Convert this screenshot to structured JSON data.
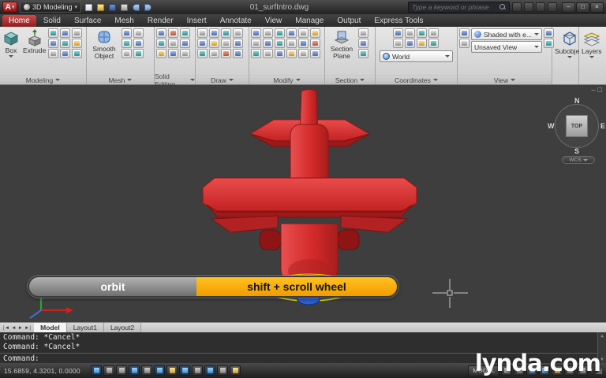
{
  "titlebar": {
    "logo_letter": "A",
    "workspace": "3D Modeling",
    "filename": "01_surfIntro.dwg",
    "search_placeholder": "Type a keyword or phrase"
  },
  "glyphs": {
    "caret": "▾",
    "minimize": "–",
    "restore": "□",
    "close": "×",
    "nav_first": "|◄",
    "nav_prev": "◄",
    "nav_next": "►",
    "nav_last": "►|",
    "scroll_up": "▲",
    "scroll_down": "▼"
  },
  "ribbon": {
    "tabs": [
      "Home",
      "Solid",
      "Surface",
      "Mesh",
      "Render",
      "Insert",
      "Annotate",
      "View",
      "Manage",
      "Output",
      "Express Tools"
    ],
    "active_tab": "Home",
    "panels": {
      "modeling": {
        "label": "Modeling",
        "box": "Box",
        "extrude": "Extrude"
      },
      "mesh": {
        "label": "Mesh",
        "smooth": "Smooth Object"
      },
      "solid_editing": {
        "label": "Solid Editing"
      },
      "draw": {
        "label": "Draw"
      },
      "modify": {
        "label": "Modify"
      },
      "section": {
        "label": "Section",
        "plane": "Section Plane"
      },
      "coordinates": {
        "label": "Coordinates",
        "world": "World"
      },
      "view": {
        "label": "View",
        "visual_style": "Shaded with e...",
        "named_view": "Unsaved View"
      },
      "subobject": {
        "button": "Subobject"
      },
      "layers": {
        "button": "Layers"
      }
    }
  },
  "viewport": {
    "viewcube": {
      "n": "N",
      "w": "W",
      "e": "E",
      "s": "S",
      "face": "TOP",
      "wcs": "WCS"
    },
    "callout": {
      "left": "orbit",
      "right": "shift + scroll wheel"
    }
  },
  "layout_tabs": {
    "model": "Model",
    "layout1": "Layout1",
    "layout2": "Layout2"
  },
  "command": {
    "history": [
      "Command: *Cancel*",
      "Command: *Cancel*"
    ],
    "prompt": "Command:"
  },
  "statusbar": {
    "coordinates": "15.6859, 4.3201, 0.0000",
    "model": "MODEL"
  },
  "watermark": "lynda.com",
  "colors": {
    "accent_orange": "#f7a800",
    "airplane_red": "#d42a2a",
    "highlight_yellow": "#e8e800",
    "spinner_blue": "#2e5ed6",
    "active_tab_red": "#9e2626"
  }
}
